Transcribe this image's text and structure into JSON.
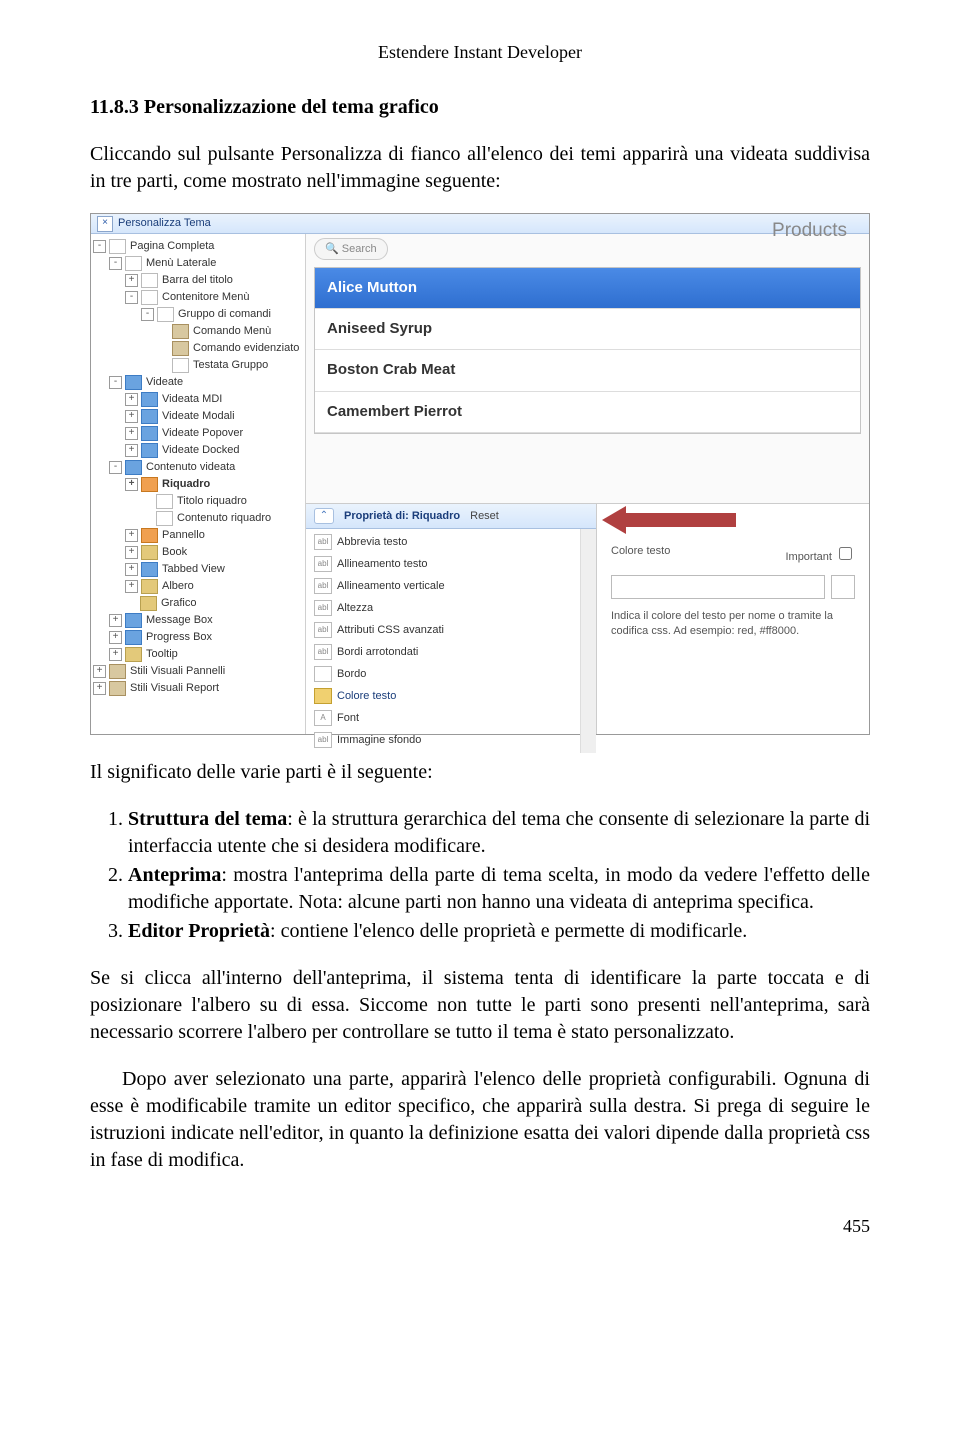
{
  "header": "Estendere Instant Developer",
  "section": "11.8.3 Personalizzazione del tema grafico",
  "intro": "Cliccando sul pulsante Personalizza di fianco all'elenco dei temi apparirà una videata suddivisa in tre parti, come mostrato nell'immagine seguente:",
  "sc": {
    "title": "Personalizza Tema",
    "tree": [
      {
        "t": "-",
        "lvl": 0,
        "ic": "white",
        "l": "Pagina Completa"
      },
      {
        "t": "-",
        "lvl": 1,
        "ic": "white",
        "l": "Menù Laterale"
      },
      {
        "t": "+",
        "lvl": 2,
        "ic": "white",
        "l": "Barra del titolo"
      },
      {
        "t": "-",
        "lvl": 2,
        "ic": "white",
        "l": "Contenitore Menù"
      },
      {
        "t": "-",
        "lvl": 3,
        "ic": "white",
        "l": "Gruppo di comandi"
      },
      {
        "t": "",
        "lvl": 4,
        "ic": "tool",
        "l": "Comando Menù"
      },
      {
        "t": "",
        "lvl": 4,
        "ic": "tool",
        "l": "Comando evidenziato"
      },
      {
        "t": "",
        "lvl": 4,
        "ic": "white",
        "l": "Testata Gruppo"
      },
      {
        "t": "-",
        "lvl": 1,
        "ic": "blue",
        "l": "Videate"
      },
      {
        "t": "+",
        "lvl": 2,
        "ic": "blue",
        "l": "Videata MDI"
      },
      {
        "t": "+",
        "lvl": 2,
        "ic": "blue",
        "l": "Videate Modali"
      },
      {
        "t": "+",
        "lvl": 2,
        "ic": "blue",
        "l": "Videate Popover"
      },
      {
        "t": "+",
        "lvl": 2,
        "ic": "blue",
        "l": "Videate Docked"
      },
      {
        "t": "-",
        "lvl": 1,
        "ic": "blue",
        "l": "Contenuto videata"
      },
      {
        "t": "+",
        "lvl": 2,
        "ic": "orange",
        "l": "Riquadro",
        "b": true
      },
      {
        "t": "",
        "lvl": 3,
        "ic": "white",
        "l": "Titolo riquadro"
      },
      {
        "t": "",
        "lvl": 3,
        "ic": "white",
        "l": "Contenuto riquadro"
      },
      {
        "t": "+",
        "lvl": 2,
        "ic": "orange",
        "l": "Pannello"
      },
      {
        "t": "+",
        "lvl": 2,
        "ic": "",
        "l": "Book"
      },
      {
        "t": "+",
        "lvl": 2,
        "ic": "blue",
        "l": "Tabbed View"
      },
      {
        "t": "+",
        "lvl": 2,
        "ic": "",
        "l": "Albero"
      },
      {
        "t": "",
        "lvl": 2,
        "ic": "",
        "l": "Grafico"
      },
      {
        "t": "+",
        "lvl": 1,
        "ic": "blue",
        "l": "Message Box"
      },
      {
        "t": "+",
        "lvl": 1,
        "ic": "blue",
        "l": "Progress Box"
      },
      {
        "t": "+",
        "lvl": 1,
        "ic": "",
        "l": "Tooltip"
      },
      {
        "t": "+",
        "lvl": 0,
        "ic": "tool",
        "l": "Stili Visuali Pannelli"
      },
      {
        "t": "+",
        "lvl": 0,
        "ic": "tool",
        "l": "Stili Visuali Report"
      }
    ],
    "search_ph": "Search",
    "products_h": "Products",
    "products": [
      "Alice Mutton",
      "Aniseed Syrup",
      "Boston Crab Meat",
      "Camembert Pierrot"
    ],
    "prop_head_label": "Proprietà di: Riquadro",
    "prop_head_reset": "Reset",
    "props": [
      {
        "l": "Abbrevia testo",
        "i": "abl"
      },
      {
        "l": "Allineamento testo",
        "i": "abl"
      },
      {
        "l": "Allineamento verticale",
        "i": "abl"
      },
      {
        "l": "Altezza",
        "i": "abl"
      },
      {
        "l": "Attributi CSS avanzati",
        "i": "abl"
      },
      {
        "l": "Bordi arrotondati",
        "i": "abl"
      },
      {
        "l": "Bordo",
        "i": ""
      },
      {
        "l": "Colore testo",
        "i": "hl"
      },
      {
        "l": "Font",
        "i": "A"
      },
      {
        "l": "Immagine sfondo",
        "i": "abl"
      }
    ],
    "right_label1": "Colore testo",
    "right_label2": "Important",
    "right_hint": "Indica il colore del testo per nome o tramite la codifica css. Ad esempio: red, #ff8000."
  },
  "after_intro": "Il significato delle varie parti è il seguente:",
  "list": [
    {
      "b": "Struttura del tema",
      "t": ": è la struttura gerarchica del tema che consente di selezionare la parte di interfaccia utente che si desidera modificare."
    },
    {
      "b": "Anteprima",
      "t": ": mostra l'anteprima della parte di tema scelta, in modo da vedere l'effetto delle modifiche apportate. Nota: alcune parti non hanno una videata di anteprima specifica."
    },
    {
      "b": "Editor Proprietà",
      "t": ": contiene l'elenco delle proprietà e permette di modificarle."
    }
  ],
  "p1": "Se si clicca all'interno dell'anteprima, il sistema tenta di identificare la parte toccata e di posizionare l'albero su di essa. Siccome non tutte le parti sono presenti nell'anteprima, sarà necessario scorrere l'albero per controllare se tutto il tema è stato personalizzato.",
  "p2": "Dopo aver selezionato una parte, apparirà l'elenco delle proprietà configurabili. Ognuna di esse è modificabile tramite un editor specifico, che apparirà sulla destra. Si prega di seguire le istruzioni indicate nell'editor, in quanto la definizione esatta dei valori dipende dalla proprietà css in fase di modifica.",
  "page": "455"
}
